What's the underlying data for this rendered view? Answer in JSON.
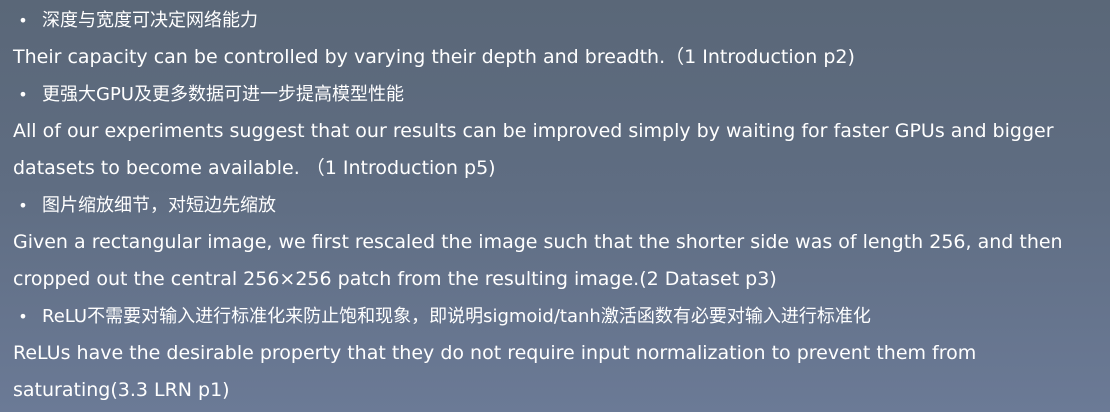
{
  "items": [
    {
      "bullet": "•",
      "heading": "深度与宽度可决定网络能力",
      "quote_lines": [
        "Their capacity can be controlled by varying their depth and breadth.（1 Introduction p2)"
      ]
    },
    {
      "bullet": "•",
      "heading": "更强大GPU及更多数据可进一步提高模型性能",
      "quote_lines": [
        "All of our experiments suggest that our results can be improved simply by waiting for faster GPUs and bigger",
        "datasets to become available. （1 Introduction p5)"
      ]
    },
    {
      "bullet": "•",
      "heading": "图片缩放细节，对短边先缩放",
      "quote_lines": [
        "Given a rectangular image, we first rescaled the image such that the shorter side was of length 256, and then",
        "cropped out the central 256×256 patch from the resulting image.(2 Dataset p3)"
      ]
    },
    {
      "bullet": "•",
      "heading": "ReLU不需要对输入进行标准化来防止饱和现象，即说明sigmoid/tanh激活函数有必要对输入进行标准化",
      "quote_lines": [
        "ReLUs have the desirable property that they do not require input normalization to prevent them from",
        "saturating(3.3 LRN p1)"
      ]
    }
  ]
}
